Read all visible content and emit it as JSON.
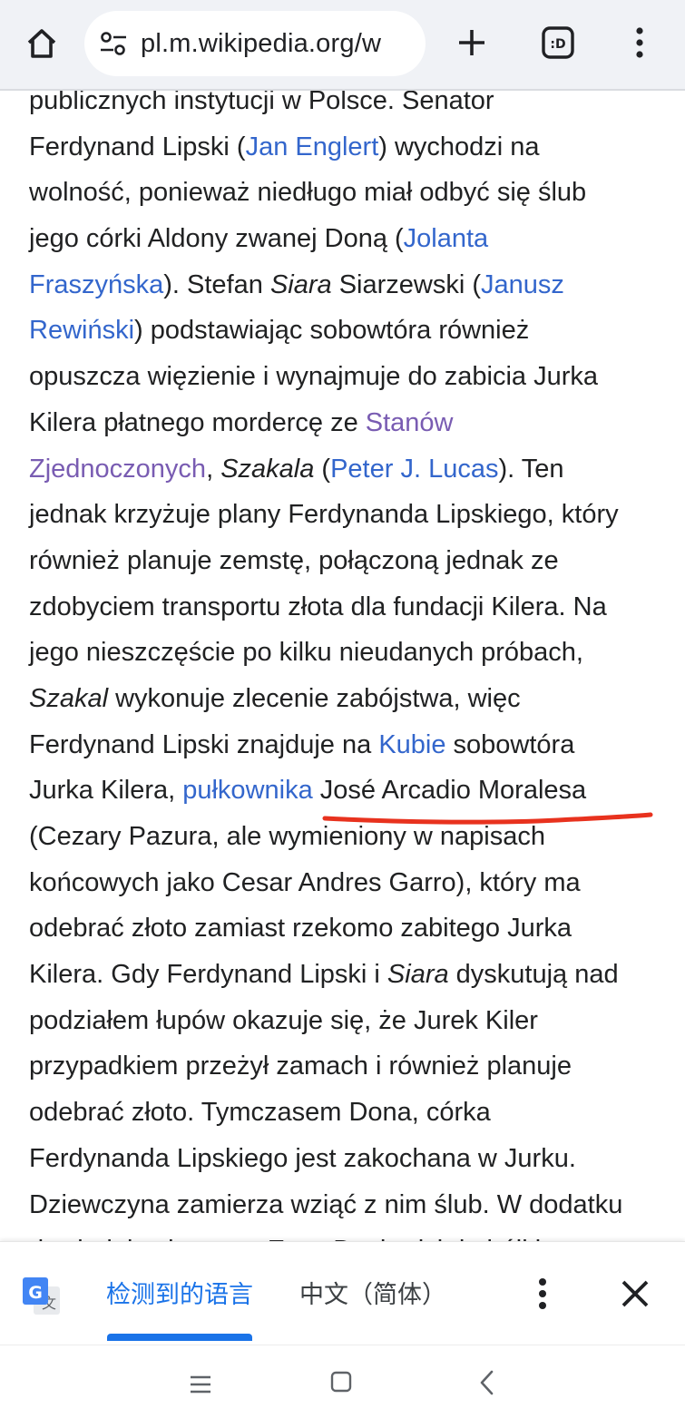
{
  "browser": {
    "url": "pl.m.wikipedia.org/w"
  },
  "article": {
    "lines": [
      [
        {
          "t": "publicznych instytucji w Polsce. Senator"
        }
      ],
      [
        {
          "t": "Ferdynand Lipski ("
        },
        {
          "t": "Jan Englert",
          "s": "link"
        },
        {
          "t": ") wychodzi na"
        }
      ],
      [
        {
          "t": "wolność, ponieważ niedługo miał odbyć się ślub"
        }
      ],
      [
        {
          "t": "jego córki Aldony zwanej Doną ("
        },
        {
          "t": "Jolanta",
          "s": "link"
        }
      ],
      [
        {
          "t": "Fraszyńska",
          "s": "link"
        },
        {
          "t": "). Stefan "
        },
        {
          "t": "Siara",
          "s": "ital"
        },
        {
          "t": " Siarzewski ("
        },
        {
          "t": "Janusz",
          "s": "link"
        }
      ],
      [
        {
          "t": "Rewiński",
          "s": "link"
        },
        {
          "t": ") podstawiając sobowtóra również"
        }
      ],
      [
        {
          "t": "opuszcza więzienie i wynajmuje do zabicia Jurka"
        }
      ],
      [
        {
          "t": "Kilera płatnego mordercę ze "
        },
        {
          "t": "Stanów",
          "s": "visited"
        }
      ],
      [
        {
          "t": "Zjednoczonych",
          "s": "visited"
        },
        {
          "t": ", "
        },
        {
          "t": "Szakala",
          "s": "ital"
        },
        {
          "t": " ("
        },
        {
          "t": "Peter J. Lucas",
          "s": "link"
        },
        {
          "t": "). Ten"
        }
      ],
      [
        {
          "t": "jednak krzyżuje plany Ferdynanda Lipskiego, który"
        }
      ],
      [
        {
          "t": "również planuje zemstę, połączoną jednak ze"
        }
      ],
      [
        {
          "t": "zdobyciem transportu złota dla fundacji Kilera. Na"
        }
      ],
      [
        {
          "t": "jego nieszczęście po kilku nieudanych próbach,"
        }
      ],
      [
        {
          "t": "Szakal",
          "s": "ital"
        },
        {
          "t": " wykonuje zlecenie zabójstwa, więc"
        }
      ],
      [
        {
          "t": "Ferdynand Lipski znajduje na "
        },
        {
          "t": "Kubie",
          "s": "link"
        },
        {
          "t": " sobowtóra"
        }
      ],
      [
        {
          "t": "Jurka Kilera, "
        },
        {
          "t": "pułkownika",
          "s": "link"
        },
        {
          "t": " José Arcadio Moralesa"
        }
      ],
      [
        {
          "t": "(Cezary Pazura, ale wymieniony w napisach"
        }
      ],
      [
        {
          "t": "końcowych jako Cesar Andres Garro), który ma"
        }
      ],
      [
        {
          "t": "odebrać złoto zamiast rzekomo zabitego Jurka"
        }
      ],
      [
        {
          "t": "Kilera. Gdy Ferdynand Lipski i "
        },
        {
          "t": "Siara",
          "s": "ital"
        },
        {
          "t": " dyskutują nad"
        }
      ],
      [
        {
          "t": "podziałem łupów okazuje się, że Jurek Kiler"
        }
      ],
      [
        {
          "t": "przypadkiem przeżył zamach i również planuje"
        }
      ],
      [
        {
          "t": "odebrać złoto. Tymczasem Dona, córka"
        }
      ],
      [
        {
          "t": "Ferdynanda Lipskiego jest zakochana w Jurku."
        }
      ],
      [
        {
          "t": "Dziewczyna zamierza wziąć z nim ślub. W dodatku"
        }
      ],
      [
        {
          "t": "dowiaduje się o tym Ewa. Dochodzi do bójki w"
        }
      ]
    ]
  },
  "translate_bar": {
    "detected_label": "检测到的语言",
    "target_label": "中文（简体）"
  },
  "colors": {
    "link": "#3366cc",
    "visited": "#795cb2",
    "annotation": "#e8321e",
    "accent": "#1a73e8"
  },
  "icons": [
    "home-icon",
    "site-settings-icon",
    "new-tab-icon",
    "tab-switcher-icon",
    "more-vert-icon",
    "google-translate-icon",
    "close-icon",
    "nav-menu-icon",
    "nav-home-icon",
    "nav-back-icon"
  ]
}
